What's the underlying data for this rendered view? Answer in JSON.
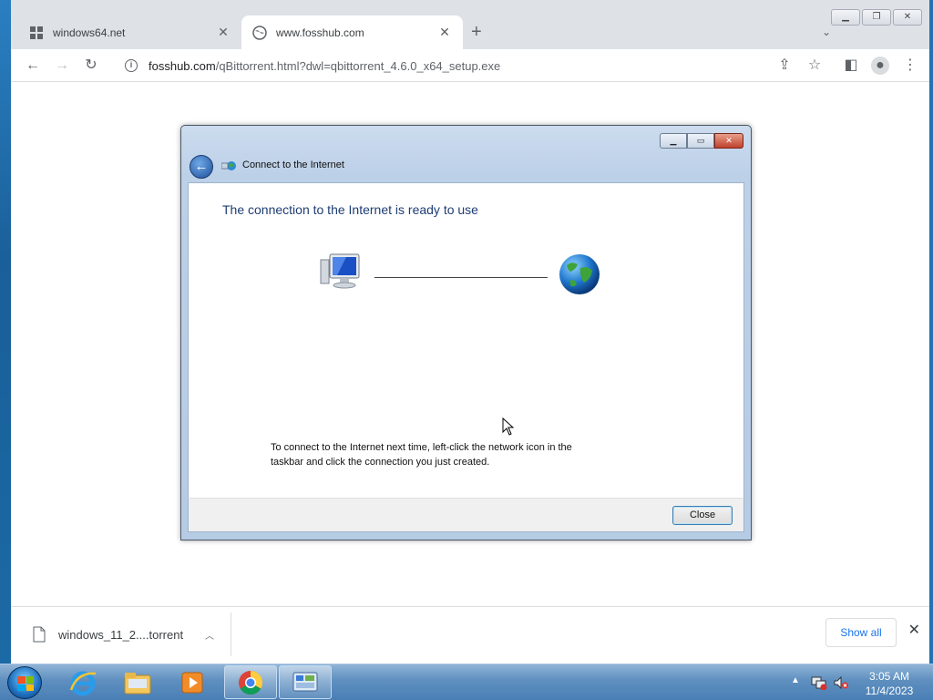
{
  "browser": {
    "tabs": [
      {
        "title": "windows64.net",
        "active": false
      },
      {
        "title": "www.fosshub.com",
        "active": true
      }
    ],
    "new_tab_label": "+",
    "omnibox": {
      "host": "fosshub.com",
      "path": "/qBittorrent.html?dwl=qbittorrent_4.6.0_x64_setup.exe"
    }
  },
  "dialog": {
    "title": "Connect to the Internet",
    "heading": "The connection to the Internet is ready to use",
    "note": "To connect to the Internet next time, left-click the network icon in the taskbar and click the connection you just created.",
    "close_button": "Close"
  },
  "downloads": {
    "item_name": "windows_11_2....torrent",
    "show_all": "Show all"
  },
  "taskbar": {
    "time": "3:05 AM",
    "date": "11/4/2023",
    "apps": [
      "windows-explorer",
      "internet-explorer",
      "file-explorer",
      "media-player",
      "chrome",
      "control-panel"
    ]
  },
  "colors": {
    "dialog_heading": "#1e3d74",
    "show_all_link": "#1a73e8",
    "taskbar": "#5e8fbf"
  }
}
